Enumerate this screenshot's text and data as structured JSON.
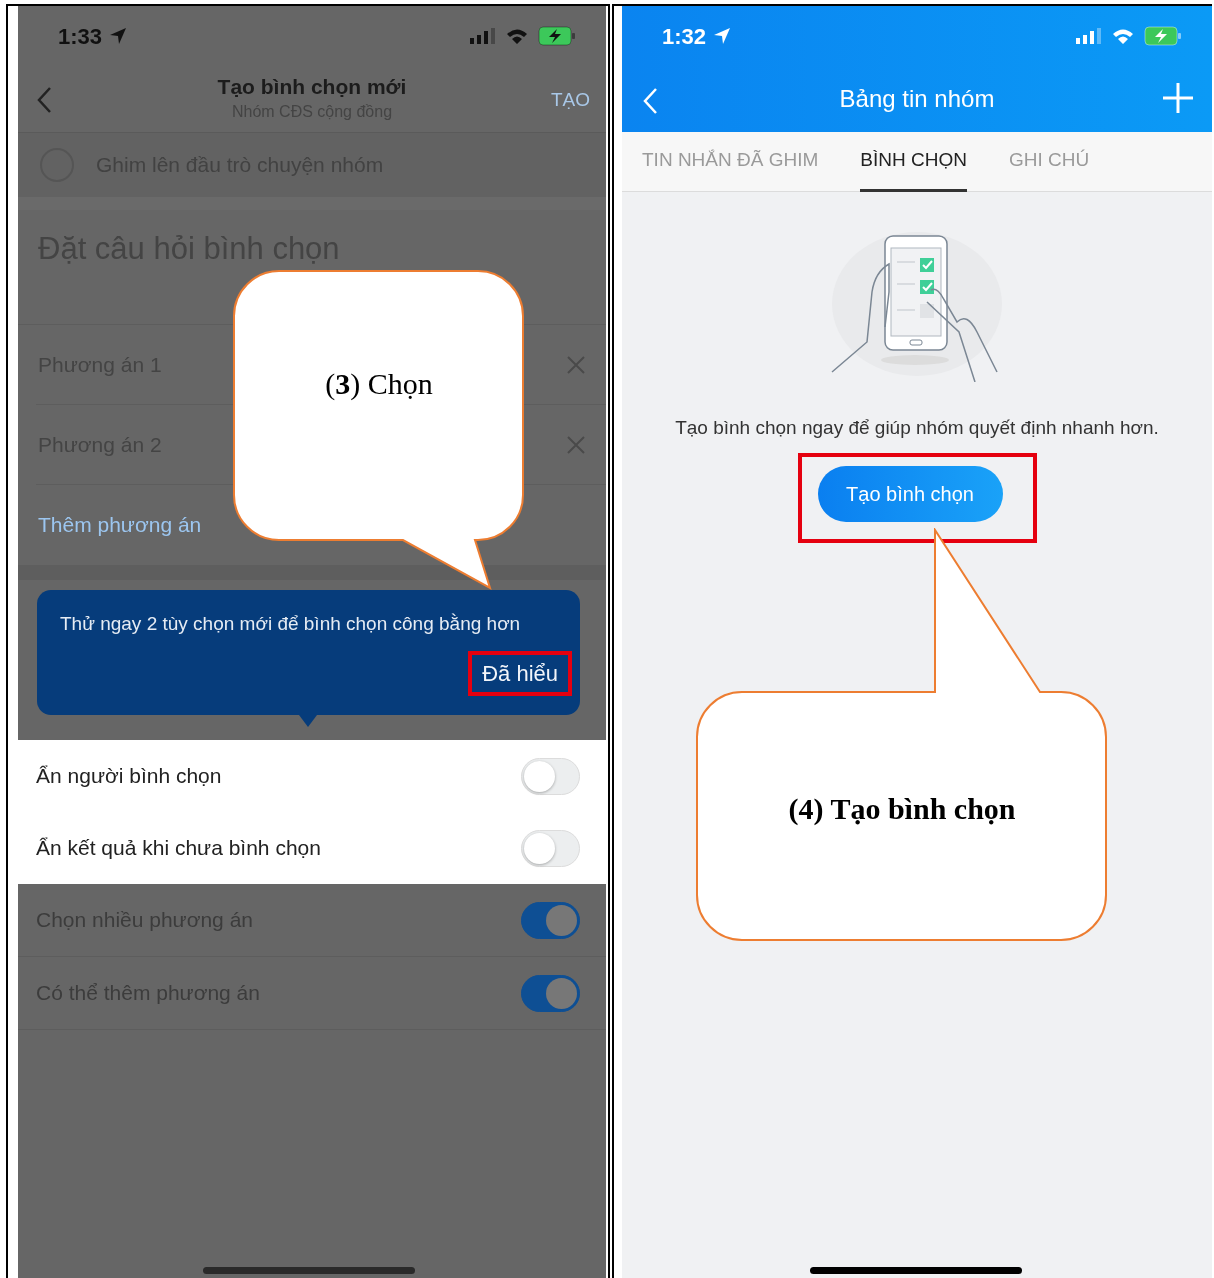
{
  "left_screen": {
    "status_bar": {
      "time": "1:33"
    },
    "header": {
      "title": "Tạo bình chọn mới",
      "subtitle": "Nhóm CĐS cộng đồng",
      "action": "TẠO"
    },
    "pin_option": {
      "label": "Ghim lên đầu trò chuyện nhóm",
      "checked": false
    },
    "question": {
      "placeholder": "Đặt câu hỏi bình chọn"
    },
    "options": [
      {
        "placeholder": "Phương án 1"
      },
      {
        "placeholder": "Phương án 2"
      }
    ],
    "add_option": "Thêm phương án",
    "tooltip": {
      "text": "Thử ngay 2 tùy chọn mới để bình chọn công bằng hơn",
      "button": "Đã hiểu",
      "highlighted": true
    },
    "settings": [
      {
        "label": "Ẩn người bình chọn",
        "on": false,
        "highlighted": true
      },
      {
        "label": "Ẩn kết quả khi chưa bình chọn",
        "on": false,
        "highlighted": true
      },
      {
        "label": "Chọn nhiều phương án",
        "on": true,
        "highlighted": false
      },
      {
        "label": "Có thể thêm phương án",
        "on": true,
        "highlighted": false
      }
    ],
    "callout": {
      "text": "(**3**) Chọn"
    }
  },
  "right_screen": {
    "status_bar": {
      "time": "1:32"
    },
    "header": {
      "title": "Bảng tin nhóm"
    },
    "tabs": [
      {
        "label": "TIN NHẮN ĐÃ GHIM",
        "selected": false
      },
      {
        "label": "BÌNH CHỌN",
        "selected": true
      },
      {
        "label": "GHI CHÚ",
        "selected": false
      }
    ],
    "empty_state": {
      "text": "Tạo bình chọn ngay để giúp nhóm quyết định nhanh hơn.",
      "button": "Tạo bình chọn",
      "highlighted": true
    },
    "callout": {
      "text": "(4) Tạo bình chọn"
    }
  }
}
